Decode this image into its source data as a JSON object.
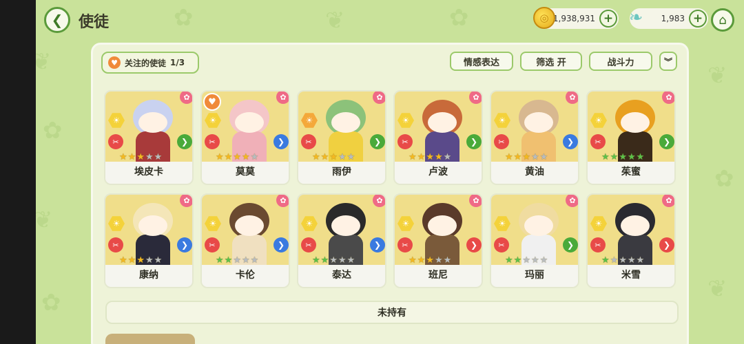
{
  "header": {
    "title": "使徒",
    "gold": "1,938,931",
    "gems": "1,983"
  },
  "toolbar": {
    "favorites_label": "关注的使徒",
    "favorites_count": "1/3",
    "emote_label": "情感表达",
    "filter_label": "筛选 开",
    "sort_label": "战斗力",
    "expand_icon": "double-chevron-down-icon"
  },
  "cards": [
    {
      "name": "埃皮卡",
      "stars": 3,
      "star_color": "gold",
      "arrow": "green",
      "favorite": false,
      "hair": "#c9d2f0",
      "outfit": "#a83a3a",
      "elem": "#f4d23a"
    },
    {
      "name": "莫莫",
      "stars": 4,
      "star_color": "gold",
      "arrow": "blue",
      "favorite": true,
      "hair": "#f4c6c8",
      "outfit": "#f0b0b8",
      "elem": "#f4d23a"
    },
    {
      "name": "雨伊",
      "stars": 3,
      "star_color": "gold",
      "arrow": "green",
      "favorite": false,
      "hair": "#8cc27a",
      "outfit": "#f0d040",
      "elem": "#f4a83a"
    },
    {
      "name": "卢波",
      "stars": 4,
      "star_color": "gold",
      "arrow": "green",
      "favorite": false,
      "hair": "#c86a3a",
      "outfit": "#5a4a8a",
      "elem": "#f4d23a"
    },
    {
      "name": "黄油",
      "stars": 3,
      "star_color": "gold",
      "arrow": "blue",
      "favorite": false,
      "hair": "#d8b890",
      "outfit": "#f0c070",
      "elem": "#f4d23a"
    },
    {
      "name": "茱蜜",
      "stars": 5,
      "star_color": "green",
      "arrow": "green",
      "favorite": false,
      "hair": "#e8a020",
      "outfit": "#3a2a1a",
      "elem": "#f4d23a"
    },
    {
      "name": "康纳",
      "stars": 3,
      "star_color": "gold",
      "arrow": "blue",
      "favorite": false,
      "hair": "#f4e6b8",
      "outfit": "#2a2a3a",
      "elem": "#f4d23a"
    },
    {
      "name": "卡伦",
      "stars": 2,
      "star_color": "green",
      "arrow": "blue",
      "favorite": false,
      "hair": "#6a4a30",
      "outfit": "#f0e0c0",
      "elem": "#f4d23a"
    },
    {
      "name": "泰达",
      "stars": 2,
      "star_color": "green",
      "arrow": "blue",
      "favorite": false,
      "hair": "#2a2a2a",
      "outfit": "#4a4a4a",
      "elem": "#f4d23a"
    },
    {
      "name": "班尼",
      "stars": 3,
      "star_color": "gold",
      "arrow": "red",
      "favorite": false,
      "hair": "#5a3a2a",
      "outfit": "#7a5a3a",
      "elem": "#f4d23a"
    },
    {
      "name": "玛丽",
      "stars": 2,
      "star_color": "green",
      "arrow": "green",
      "favorite": false,
      "hair": "#f0dca0",
      "outfit": "#f0f0f0",
      "elem": "#f4d23a"
    },
    {
      "name": "米雪",
      "stars": 1,
      "star_color": "green",
      "arrow": "red",
      "favorite": false,
      "hair": "#2a2a30",
      "outfit": "#3a3a40",
      "elem": "#f4d23a"
    }
  ],
  "unowned_label": "未持有",
  "colors": {
    "background": "#c9e29a",
    "panel": "#eef3d8",
    "accent_green": "#5a9a3a",
    "star_gold": "#f4b820",
    "star_green": "#5cc04a",
    "star_empty": "#b8bcc0"
  }
}
